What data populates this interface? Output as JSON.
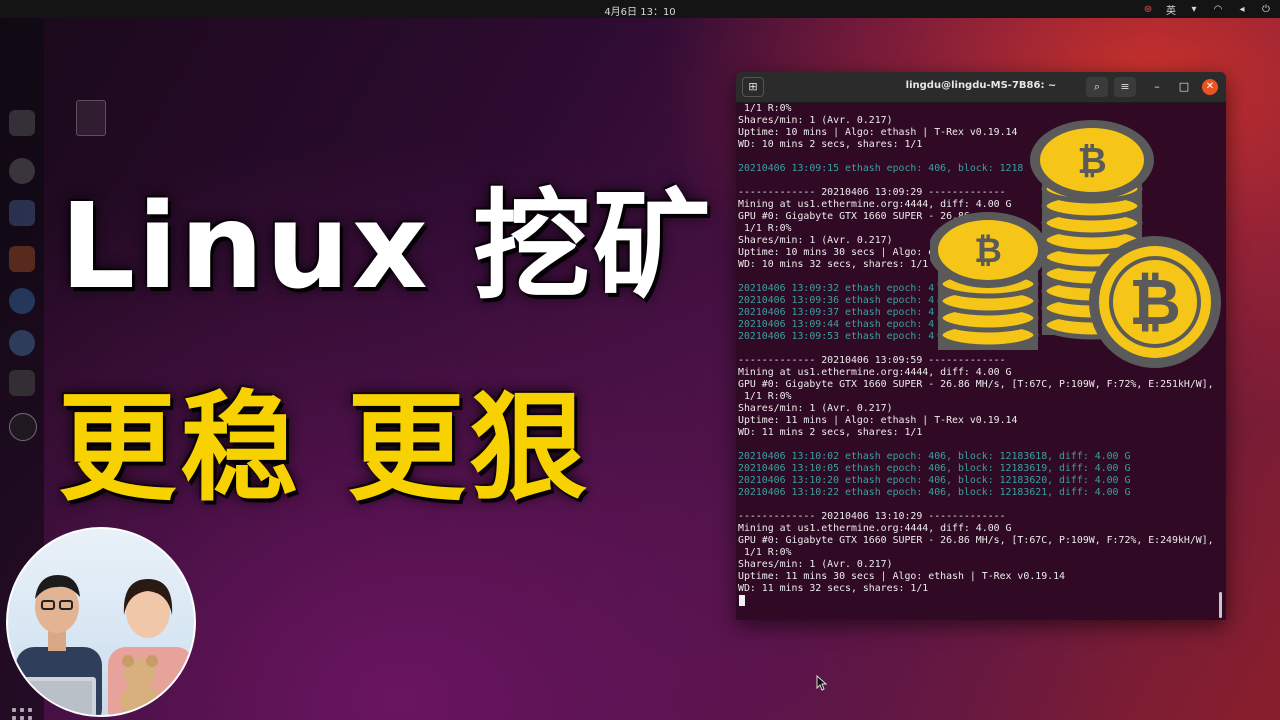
{
  "topbar": {
    "clock": "4月6日  13：10",
    "input_method": "英",
    "tray_icons": [
      "app-indicator-icon",
      "input-method-icon",
      "wifi-icon",
      "volume-icon",
      "power-icon"
    ]
  },
  "terminal": {
    "title": "lingdu@lingdu-MS-7B86: ~",
    "lines": [
      {
        "text": " 1/1 R:0%",
        "color": "white"
      },
      {
        "text": "Shares/min: 1 (Avr. 0.217)",
        "color": "white"
      },
      {
        "text": "Uptime: 10 mins | Algo: ethash | T-Rex v0.19.14",
        "color": "white"
      },
      {
        "text": "WD: 10 mins 2 secs, shares: 1/1",
        "color": "white"
      },
      {
        "text": "",
        "color": "white"
      },
      {
        "text": "20210406 13:09:15 ethash epoch: 406, block: 1218",
        "color": "teal"
      },
      {
        "text": "",
        "color": "white"
      },
      {
        "text": "------------- 20210406 13:09:29 -------------",
        "color": "white"
      },
      {
        "text": "Mining at us1.ethermine.org:4444, diff: 4.00 G",
        "color": "white"
      },
      {
        "text": "GPU #0: Gigabyte GTX 1660 SUPER - 26.86",
        "color": "white"
      },
      {
        "text": " 1/1 R:0%",
        "color": "white"
      },
      {
        "text": "Shares/min: 1 (Avr. 0.217)",
        "color": "white"
      },
      {
        "text": "Uptime: 10 mins 30 secs | Algo: e",
        "color": "white"
      },
      {
        "text": "WD: 10 mins 32 secs, shares: 1/1",
        "color": "white"
      },
      {
        "text": "",
        "color": "white"
      },
      {
        "text": "20210406 13:09:32 ethash epoch: 4",
        "color": "teal"
      },
      {
        "text": "20210406 13:09:36 ethash epoch: 4",
        "color": "teal"
      },
      {
        "text": "20210406 13:09:37 ethash epoch: 4",
        "color": "teal"
      },
      {
        "text": "20210406 13:09:44 ethash epoch: 4",
        "color": "teal"
      },
      {
        "text": "20210406 13:09:53 ethash epoch: 4",
        "color": "teal"
      },
      {
        "text": "",
        "color": "white"
      },
      {
        "text": "------------- 20210406 13:09:59 -------------",
        "color": "white"
      },
      {
        "text": "Mining at us1.ethermine.org:4444, diff: 4.00 G",
        "color": "white"
      },
      {
        "text": "GPU #0: Gigabyte GTX 1660 SUPER - 26.86 MH/s, [T:67C, P:109W, F:72%, E:251kH/W],",
        "color": "white"
      },
      {
        "text": " 1/1 R:0%",
        "color": "white"
      },
      {
        "text": "Shares/min: 1 (Avr. 0.217)",
        "color": "white"
      },
      {
        "text": "Uptime: 11 mins | Algo: ethash | T-Rex v0.19.14",
        "color": "white"
      },
      {
        "text": "WD: 11 mins 2 secs, shares: 1/1",
        "color": "white"
      },
      {
        "text": "",
        "color": "white"
      },
      {
        "text": "20210406 13:10:02 ethash epoch: 406, block: 12183618, diff: 4.00 G",
        "color": "teal"
      },
      {
        "text": "20210406 13:10:05 ethash epoch: 406, block: 12183619, diff: 4.00 G",
        "color": "teal"
      },
      {
        "text": "20210406 13:10:20 ethash epoch: 406, block: 12183620, diff: 4.00 G",
        "color": "teal"
      },
      {
        "text": "20210406 13:10:22 ethash epoch: 406, block: 12183621, diff: 4.00 G",
        "color": "teal"
      },
      {
        "text": "",
        "color": "white"
      },
      {
        "text": "------------- 20210406 13:10:29 -------------",
        "color": "white"
      },
      {
        "text": "Mining at us1.ethermine.org:4444, diff: 4.00 G",
        "color": "white"
      },
      {
        "text": "GPU #0: Gigabyte GTX 1660 SUPER - 26.86 MH/s, [T:67C, P:109W, F:72%, E:249kH/W],",
        "color": "white"
      },
      {
        "text": " 1/1 R:0%",
        "color": "white"
      },
      {
        "text": "Shares/min: 1 (Avr. 0.217)",
        "color": "white"
      },
      {
        "text": "Uptime: 11 mins 30 secs | Algo: ethash | T-Rex v0.19.14",
        "color": "white"
      },
      {
        "text": "WD: 11 mins 32 secs, shares: 1/1",
        "color": "white"
      },
      {
        "text": "",
        "color": "white"
      }
    ]
  },
  "overlay": {
    "title_line1": "Linux 挖矿",
    "title_line2": "更稳 更狠"
  },
  "colors": {
    "terminal_bg": "#300a24",
    "teal_text": "#3aa0a0",
    "title_yellow": "#f7d200",
    "coin_gold": "#f5c518",
    "coin_rim": "#5a5a5a"
  },
  "icons": {
    "coins": "bitcoin-coin-stack-icon",
    "avatar": "presenters-avatar"
  }
}
